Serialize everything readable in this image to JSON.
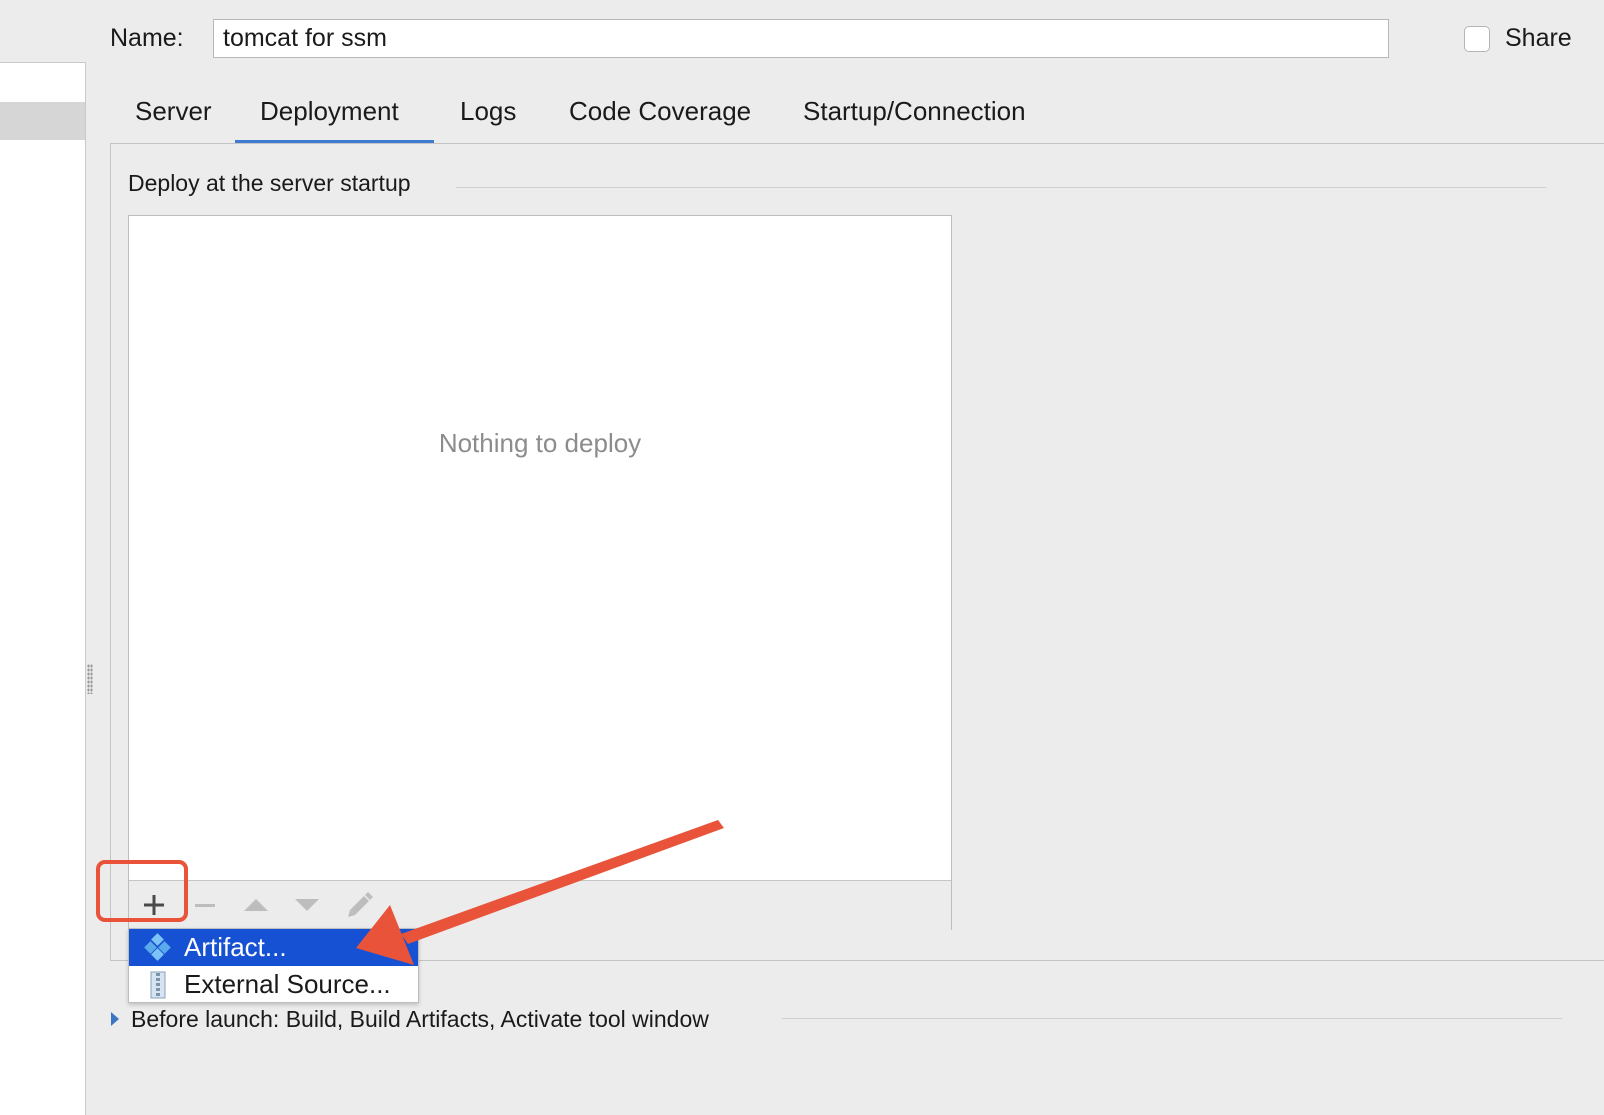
{
  "name_row": {
    "label": "Name:",
    "value": "tomcat for ssm",
    "share_label": "Share"
  },
  "tabs": [
    {
      "label": "Server",
      "active": false
    },
    {
      "label": "Deployment",
      "active": true
    },
    {
      "label": "Logs",
      "active": false
    },
    {
      "label": "Code Coverage",
      "active": false
    },
    {
      "label": "Startup/Connection",
      "active": false
    }
  ],
  "deploy": {
    "group_title": "Deploy at the server startup",
    "empty_text": "Nothing to deploy",
    "toolbar": [
      {
        "name": "add",
        "icon": "plus-icon",
        "enabled": true
      },
      {
        "name": "remove",
        "icon": "minus-icon",
        "enabled": false
      },
      {
        "name": "move-up",
        "icon": "triangle-up-icon",
        "enabled": false
      },
      {
        "name": "move-down",
        "icon": "triangle-down-icon",
        "enabled": false
      },
      {
        "name": "edit",
        "icon": "pencil-icon",
        "enabled": false
      }
    ]
  },
  "popup_menu": {
    "items": [
      {
        "label": "Artifact...",
        "icon": "artifact-icon",
        "selected": true
      },
      {
        "label": "External Source...",
        "icon": "archive-icon",
        "selected": false
      }
    ]
  },
  "before_launch": {
    "text": "Before launch: Build, Build Artifacts, Activate tool window"
  },
  "colors": {
    "tab_underline": "#3d7cd1",
    "menu_selection": "#1751d3",
    "annotation": "#e8533a"
  }
}
